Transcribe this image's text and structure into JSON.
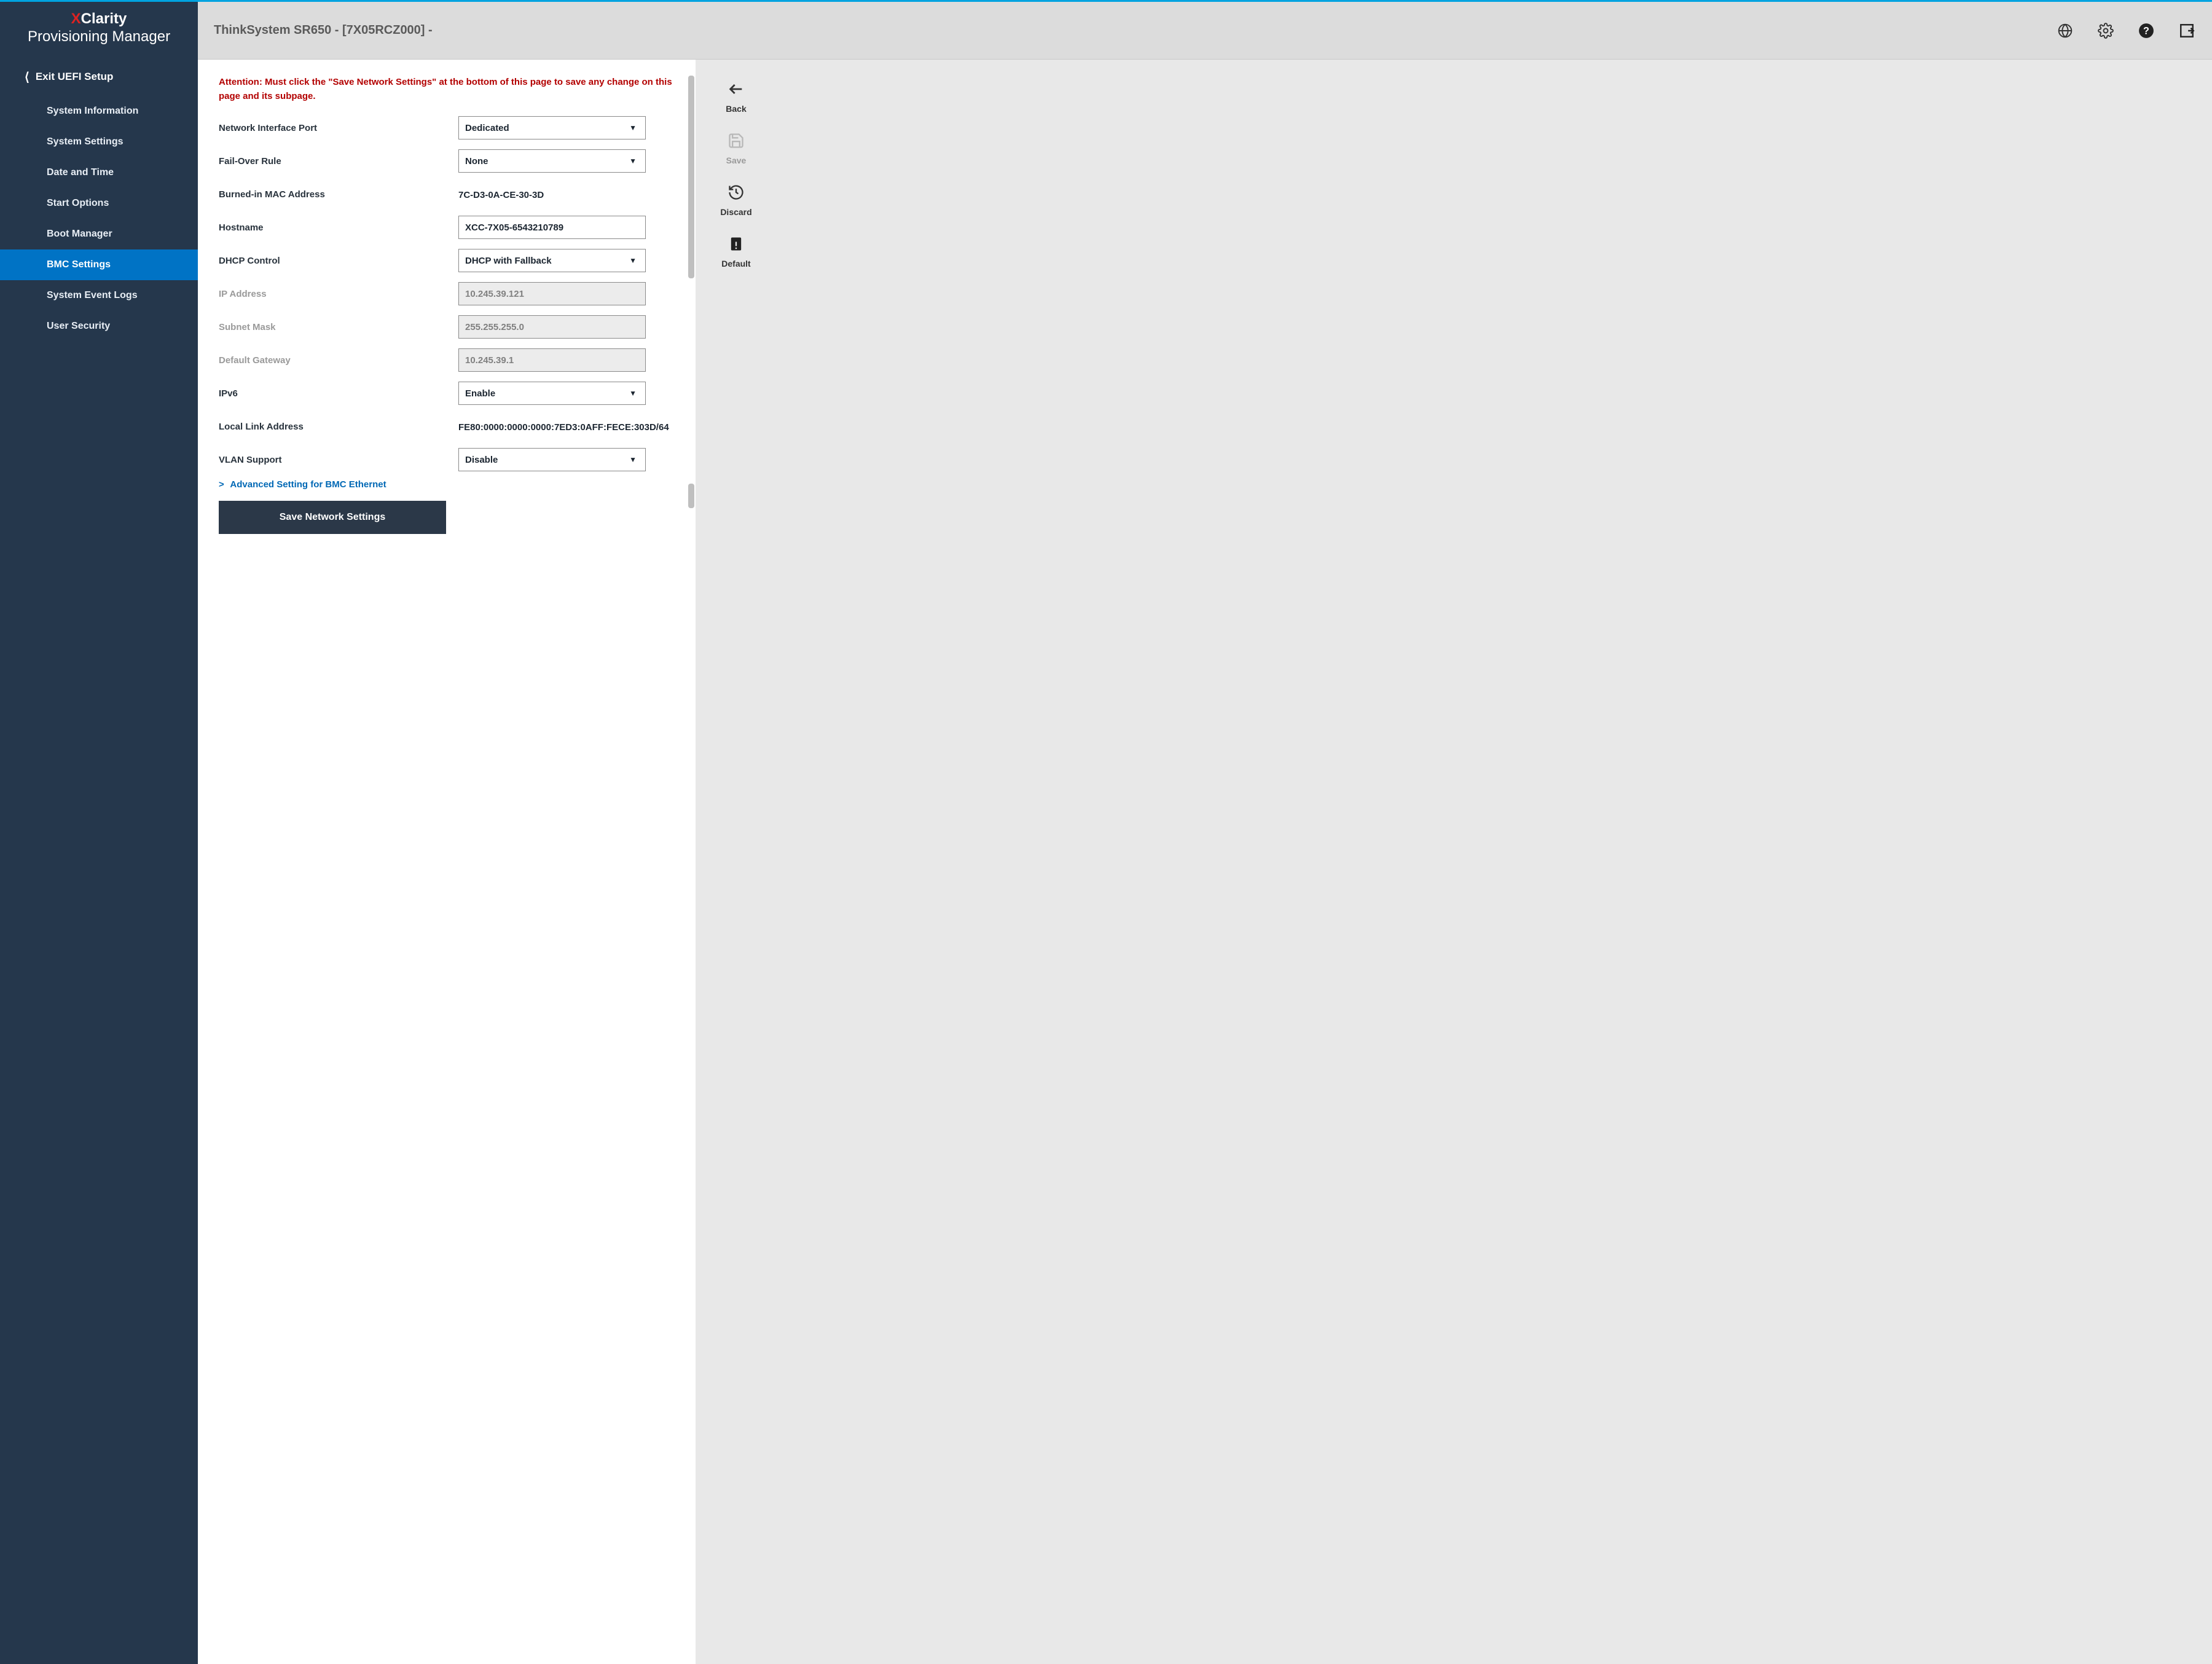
{
  "brand": {
    "x": "X",
    "rest": "Clarity",
    "sub": "Provisioning Manager"
  },
  "sidebar": {
    "exit": "Exit UEFI Setup",
    "items": [
      "System Information",
      "System Settings",
      "Date and Time",
      "Start Options",
      "Boot Manager",
      "BMC Settings",
      "System Event Logs",
      "User Security"
    ],
    "active_index": 5
  },
  "header": {
    "title": "ThinkSystem SR650 - [7X05RCZ000] -"
  },
  "form": {
    "attention": "Attention: Must click the \"Save Network Settings\" at the bottom of this page to save any change on this page and its subpage.",
    "rows": {
      "nic_port": {
        "label": "Network Interface Port",
        "value": "Dedicated"
      },
      "failover": {
        "label": "Fail-Over Rule",
        "value": "None"
      },
      "mac": {
        "label": "Burned-in MAC Address",
        "value": "7C-D3-0A-CE-30-3D"
      },
      "hostname": {
        "label": "Hostname",
        "value": "XCC-7X05-6543210789"
      },
      "dhcp": {
        "label": "DHCP Control",
        "value": "DHCP with Fallback"
      },
      "ip": {
        "label": "IP Address",
        "value": "10.245.39.121"
      },
      "subnet": {
        "label": "Subnet Mask",
        "value": "255.255.255.0"
      },
      "gateway": {
        "label": "Default Gateway",
        "value": "10.245.39.1"
      },
      "ipv6": {
        "label": "IPv6",
        "value": "Enable"
      },
      "lla": {
        "label": "Local Link Address",
        "value": "FE80:0000:0000:0000:7ED3:0AFF:FECE:303D/64"
      },
      "vlan": {
        "label": "VLAN Support",
        "value": "Disable"
      }
    },
    "advanced_link": "Advanced Setting for BMC Ethernet",
    "save_button": "Save Network Settings"
  },
  "right_actions": {
    "back": "Back",
    "save": "Save",
    "discard": "Discard",
    "default": "Default"
  }
}
